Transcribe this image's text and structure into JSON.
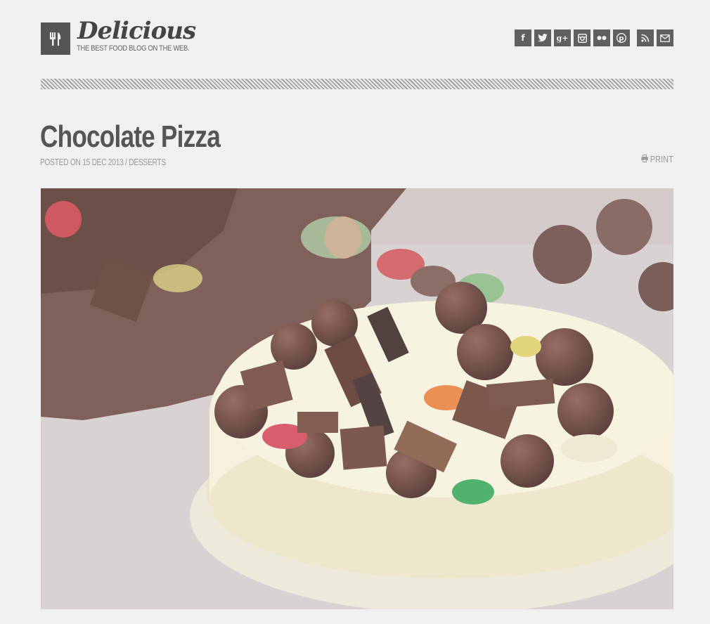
{
  "header": {
    "logo_icon": "fork-knife-icon",
    "site_title": "Delicious",
    "tagline": "THE BEST FOOD BLOG ON THE WEB.",
    "social": [
      {
        "name": "facebook-icon",
        "glyph": "f"
      },
      {
        "name": "twitter-icon",
        "glyph": "t"
      },
      {
        "name": "googleplus-icon",
        "glyph": "g+"
      },
      {
        "name": "instagram-icon",
        "glyph": "◙"
      },
      {
        "name": "flickr-icon",
        "glyph": "••"
      },
      {
        "name": "pinterest-icon",
        "glyph": "P"
      },
      {
        "name": "rss-icon",
        "glyph": "◥"
      },
      {
        "name": "email-icon",
        "glyph": "✉"
      }
    ]
  },
  "post": {
    "title": "Chocolate Pizza",
    "meta_prefix": "POSTED ON 15 DEC 2013 /",
    "category": "DESSERTS",
    "print_label": "PRINT",
    "image_alt": "Chocolate Pizza photo"
  },
  "colors": {
    "background": "#f0f0f0",
    "icon_bg": "#5f5f5f",
    "title": "#555555",
    "meta": "#999999"
  }
}
